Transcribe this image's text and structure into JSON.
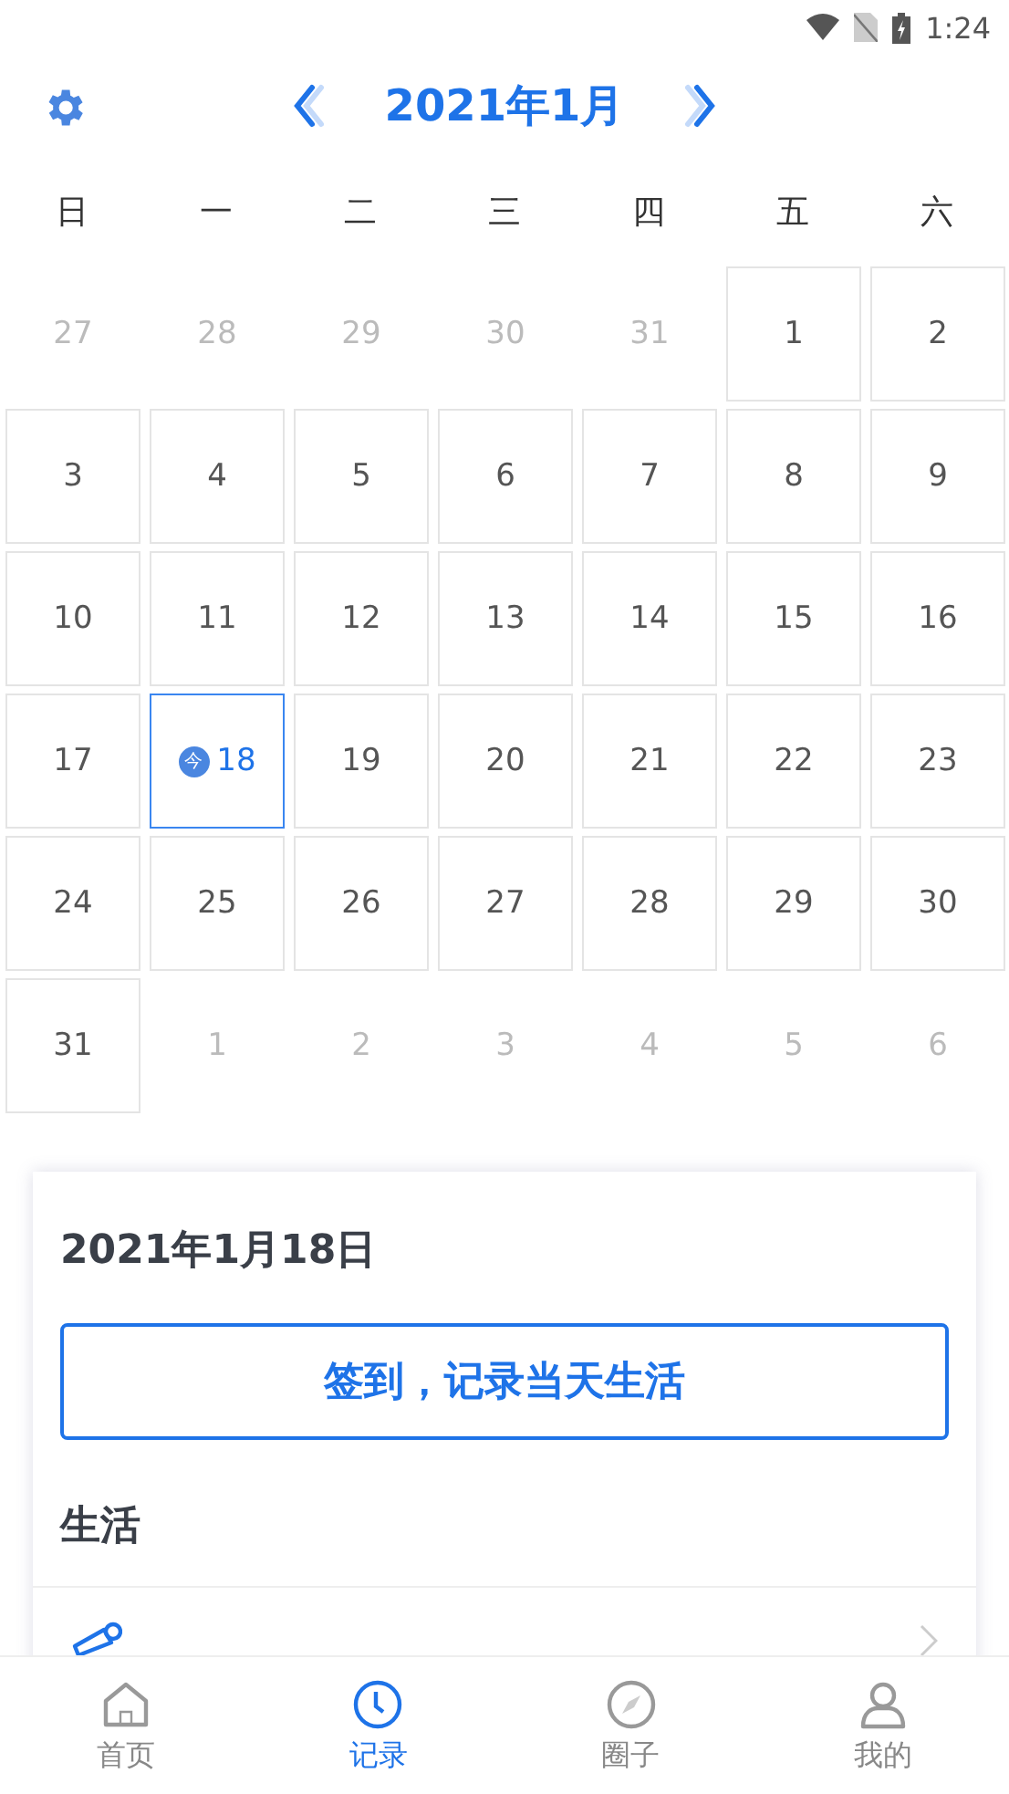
{
  "status_bar": {
    "time": "1:24"
  },
  "header": {
    "title": "2021年1月"
  },
  "weekdays": [
    "日",
    "一",
    "二",
    "三",
    "四",
    "五",
    "六"
  ],
  "days": [
    {
      "label": "27",
      "in_month": false,
      "selected": false
    },
    {
      "label": "28",
      "in_month": false,
      "selected": false
    },
    {
      "label": "29",
      "in_month": false,
      "selected": false
    },
    {
      "label": "30",
      "in_month": false,
      "selected": false
    },
    {
      "label": "31",
      "in_month": false,
      "selected": false
    },
    {
      "label": "1",
      "in_month": true,
      "selected": false
    },
    {
      "label": "2",
      "in_month": true,
      "selected": false
    },
    {
      "label": "3",
      "in_month": true,
      "selected": false
    },
    {
      "label": "4",
      "in_month": true,
      "selected": false
    },
    {
      "label": "5",
      "in_month": true,
      "selected": false
    },
    {
      "label": "6",
      "in_month": true,
      "selected": false
    },
    {
      "label": "7",
      "in_month": true,
      "selected": false
    },
    {
      "label": "8",
      "in_month": true,
      "selected": false
    },
    {
      "label": "9",
      "in_month": true,
      "selected": false
    },
    {
      "label": "10",
      "in_month": true,
      "selected": false
    },
    {
      "label": "11",
      "in_month": true,
      "selected": false
    },
    {
      "label": "12",
      "in_month": true,
      "selected": false
    },
    {
      "label": "13",
      "in_month": true,
      "selected": false
    },
    {
      "label": "14",
      "in_month": true,
      "selected": false
    },
    {
      "label": "15",
      "in_month": true,
      "selected": false
    },
    {
      "label": "16",
      "in_month": true,
      "selected": false
    },
    {
      "label": "17",
      "in_month": true,
      "selected": false
    },
    {
      "label": "18",
      "in_month": true,
      "selected": true,
      "today_mark": "今"
    },
    {
      "label": "19",
      "in_month": true,
      "selected": false
    },
    {
      "label": "20",
      "in_month": true,
      "selected": false
    },
    {
      "label": "21",
      "in_month": true,
      "selected": false
    },
    {
      "label": "22",
      "in_month": true,
      "selected": false
    },
    {
      "label": "23",
      "in_month": true,
      "selected": false
    },
    {
      "label": "24",
      "in_month": true,
      "selected": false
    },
    {
      "label": "25",
      "in_month": true,
      "selected": false
    },
    {
      "label": "26",
      "in_month": true,
      "selected": false
    },
    {
      "label": "27",
      "in_month": true,
      "selected": false
    },
    {
      "label": "28",
      "in_month": true,
      "selected": false
    },
    {
      "label": "29",
      "in_month": true,
      "selected": false
    },
    {
      "label": "30",
      "in_month": true,
      "selected": false
    },
    {
      "label": "31",
      "in_month": true,
      "selected": false
    },
    {
      "label": "1",
      "in_month": false,
      "selected": false
    },
    {
      "label": "2",
      "in_month": false,
      "selected": false
    },
    {
      "label": "3",
      "in_month": false,
      "selected": false
    },
    {
      "label": "4",
      "in_month": false,
      "selected": false
    },
    {
      "label": "5",
      "in_month": false,
      "selected": false
    },
    {
      "label": "6",
      "in_month": false,
      "selected": false
    }
  ],
  "detail": {
    "date": "2021年1月18日",
    "checkin_button": "签到，记录当天生活",
    "section": "生活"
  },
  "tabs": [
    {
      "label": "首页",
      "kind": "home",
      "selected": false
    },
    {
      "label": "记录",
      "kind": "clock",
      "selected": true
    },
    {
      "label": "圈子",
      "kind": "compass",
      "selected": false
    },
    {
      "label": "我的",
      "kind": "person",
      "selected": false
    }
  ]
}
